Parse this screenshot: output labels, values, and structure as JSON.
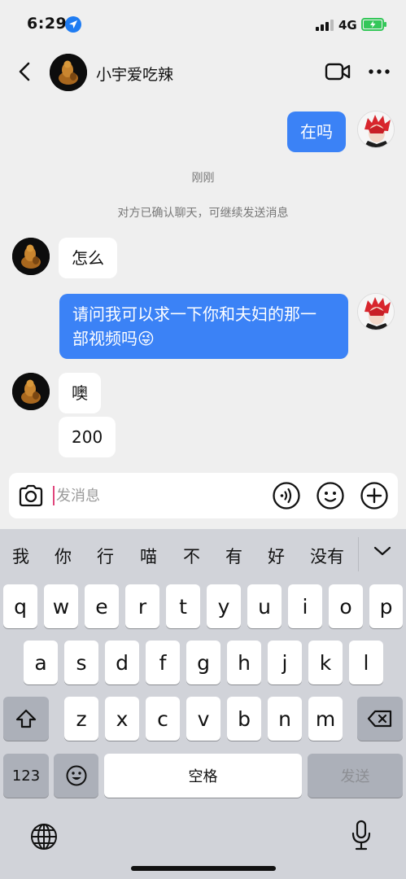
{
  "status": {
    "time": "6:29",
    "network": "4G"
  },
  "header": {
    "contact_name": "小宇爱吃辣"
  },
  "messages": [
    {
      "from": "me",
      "text": "在吗"
    },
    {
      "from": "system",
      "text": "刚刚"
    },
    {
      "from": "system",
      "text": "对方已确认聊天，可继续发送消息"
    },
    {
      "from": "other",
      "text": "怎么"
    },
    {
      "from": "me",
      "text_line1": "请问我可以求一下你和夫妇的那一",
      "text_line2": "部视频吗",
      "emoji": "😜"
    },
    {
      "from": "other",
      "text": "噢"
    },
    {
      "from": "other",
      "text": "200"
    }
  ],
  "composer": {
    "placeholder": "发消息",
    "value": ""
  },
  "keyboard": {
    "candidates": [
      "我",
      "你",
      "行",
      "喵",
      "不",
      "有",
      "好",
      "没有"
    ],
    "row1": [
      "q",
      "w",
      "e",
      "r",
      "t",
      "y",
      "u",
      "i",
      "o",
      "p"
    ],
    "row2": [
      "a",
      "s",
      "d",
      "f",
      "g",
      "h",
      "j",
      "k",
      "l"
    ],
    "row3": [
      "z",
      "x",
      "c",
      "v",
      "b",
      "n",
      "m"
    ],
    "numbers_key": "123",
    "space_key": "空格",
    "send_key": "发送"
  },
  "icons": {
    "back": "chevron-left-icon",
    "video": "video-call-icon",
    "more": "more-dots-icon",
    "camera": "camera-icon",
    "voice": "voice-icon",
    "emoji": "emoji-icon",
    "plus": "plus-icon",
    "shift": "shift-icon",
    "delete": "delete-icon",
    "globe": "globe-icon",
    "mic": "microphone-icon"
  },
  "colors": {
    "my_bubble": "#3b82f6",
    "chat_bg": "#efefef",
    "keyboard_bg": "#d1d3d9",
    "battery": "#34c759",
    "location": "#1f7cf2"
  }
}
